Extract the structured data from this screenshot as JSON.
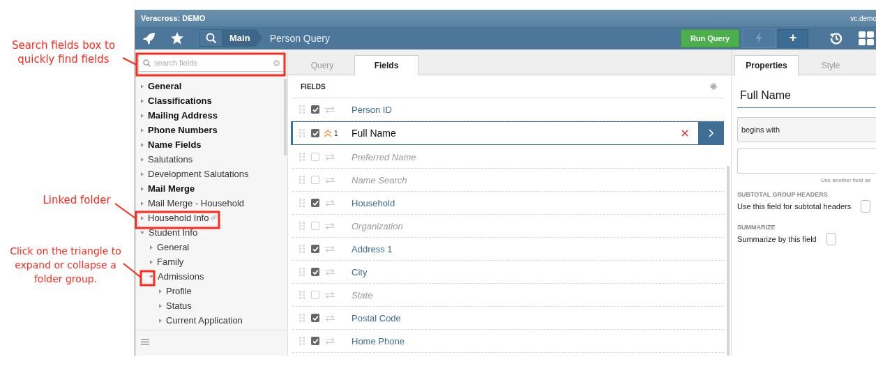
{
  "annotations": [
    {
      "text": "Search fields box to quickly find fields"
    },
    {
      "text": "Linked folder"
    },
    {
      "text": "Click on the triangle to expand or collapse a folder group."
    }
  ],
  "window": {
    "title": "Veracross: DEMO",
    "user": "vc.demo"
  },
  "toolbar": {
    "breadcrumb": [
      {
        "label": "Main"
      },
      {
        "label": "Person Query"
      }
    ],
    "run_button": "Run Query",
    "add_button": "+"
  },
  "sidebar": {
    "search": {
      "placeholder": "search fields"
    },
    "tree": [
      {
        "label": "General",
        "bold": true,
        "expanded": false
      },
      {
        "label": "Classifications",
        "bold": true,
        "expanded": false
      },
      {
        "label": "Mailing Address",
        "bold": true,
        "expanded": false
      },
      {
        "label": "Phone Numbers",
        "bold": true,
        "expanded": false
      },
      {
        "label": "Name Fields",
        "bold": true,
        "expanded": false
      },
      {
        "label": "Salutations",
        "bold": false,
        "expanded": false
      },
      {
        "label": "Development Salutations",
        "bold": false,
        "expanded": false
      },
      {
        "label": "Mail Merge",
        "bold": true,
        "expanded": false
      },
      {
        "label": "Mail Merge - Household",
        "bold": false,
        "expanded": false
      },
      {
        "label": "Household Info",
        "bold": false,
        "expanded": false,
        "linked": true
      },
      {
        "label": "Student Info",
        "bold": false,
        "expanded": true,
        "children": [
          {
            "label": "General",
            "bold": false,
            "expanded": false
          },
          {
            "label": "Family",
            "bold": false,
            "expanded": false
          },
          {
            "label": "Admissions",
            "bold": false,
            "expanded": true,
            "children": [
              {
                "label": "Profile",
                "bold": false,
                "expanded": false
              },
              {
                "label": "Status",
                "bold": false,
                "expanded": false
              },
              {
                "label": "Current Application",
                "bold": false,
                "expanded": false
              }
            ]
          }
        ]
      }
    ]
  },
  "tabs": [
    {
      "label": "Query",
      "selected": false
    },
    {
      "label": "Fields",
      "selected": true
    }
  ],
  "fields": {
    "heading": "FIELDS",
    "rows": [
      {
        "label": "Person ID",
        "checked": true,
        "selected": false
      },
      {
        "label": "Full Name",
        "checked": true,
        "selected": true,
        "sort_order": "1"
      },
      {
        "label": "Preferred Name",
        "checked": false,
        "selected": false
      },
      {
        "label": "Name Search",
        "checked": false,
        "selected": false
      },
      {
        "label": "Household",
        "checked": true,
        "selected": false
      },
      {
        "label": "Organization",
        "checked": false,
        "selected": false
      },
      {
        "label": "Address 1",
        "checked": true,
        "selected": false
      },
      {
        "label": "City",
        "checked": true,
        "selected": false
      },
      {
        "label": "State",
        "checked": false,
        "selected": false
      },
      {
        "label": "Postal Code",
        "checked": true,
        "selected": false
      },
      {
        "label": "Home Phone",
        "checked": true,
        "selected": false
      }
    ]
  },
  "properties": {
    "tabs": [
      {
        "label": "Properties",
        "selected": true
      },
      {
        "label": "Style",
        "selected": false
      }
    ],
    "field_name": "Full Name",
    "operator": "begins with",
    "hint": "Use another field as",
    "options": [
      {
        "heading": "SUBTOTAL GROUP HEADERS",
        "label": "Use this field for subtotal headers",
        "checked": false
      },
      {
        "heading": "SUMMARIZE",
        "label": "Summarize by this field",
        "checked": false
      }
    ]
  }
}
